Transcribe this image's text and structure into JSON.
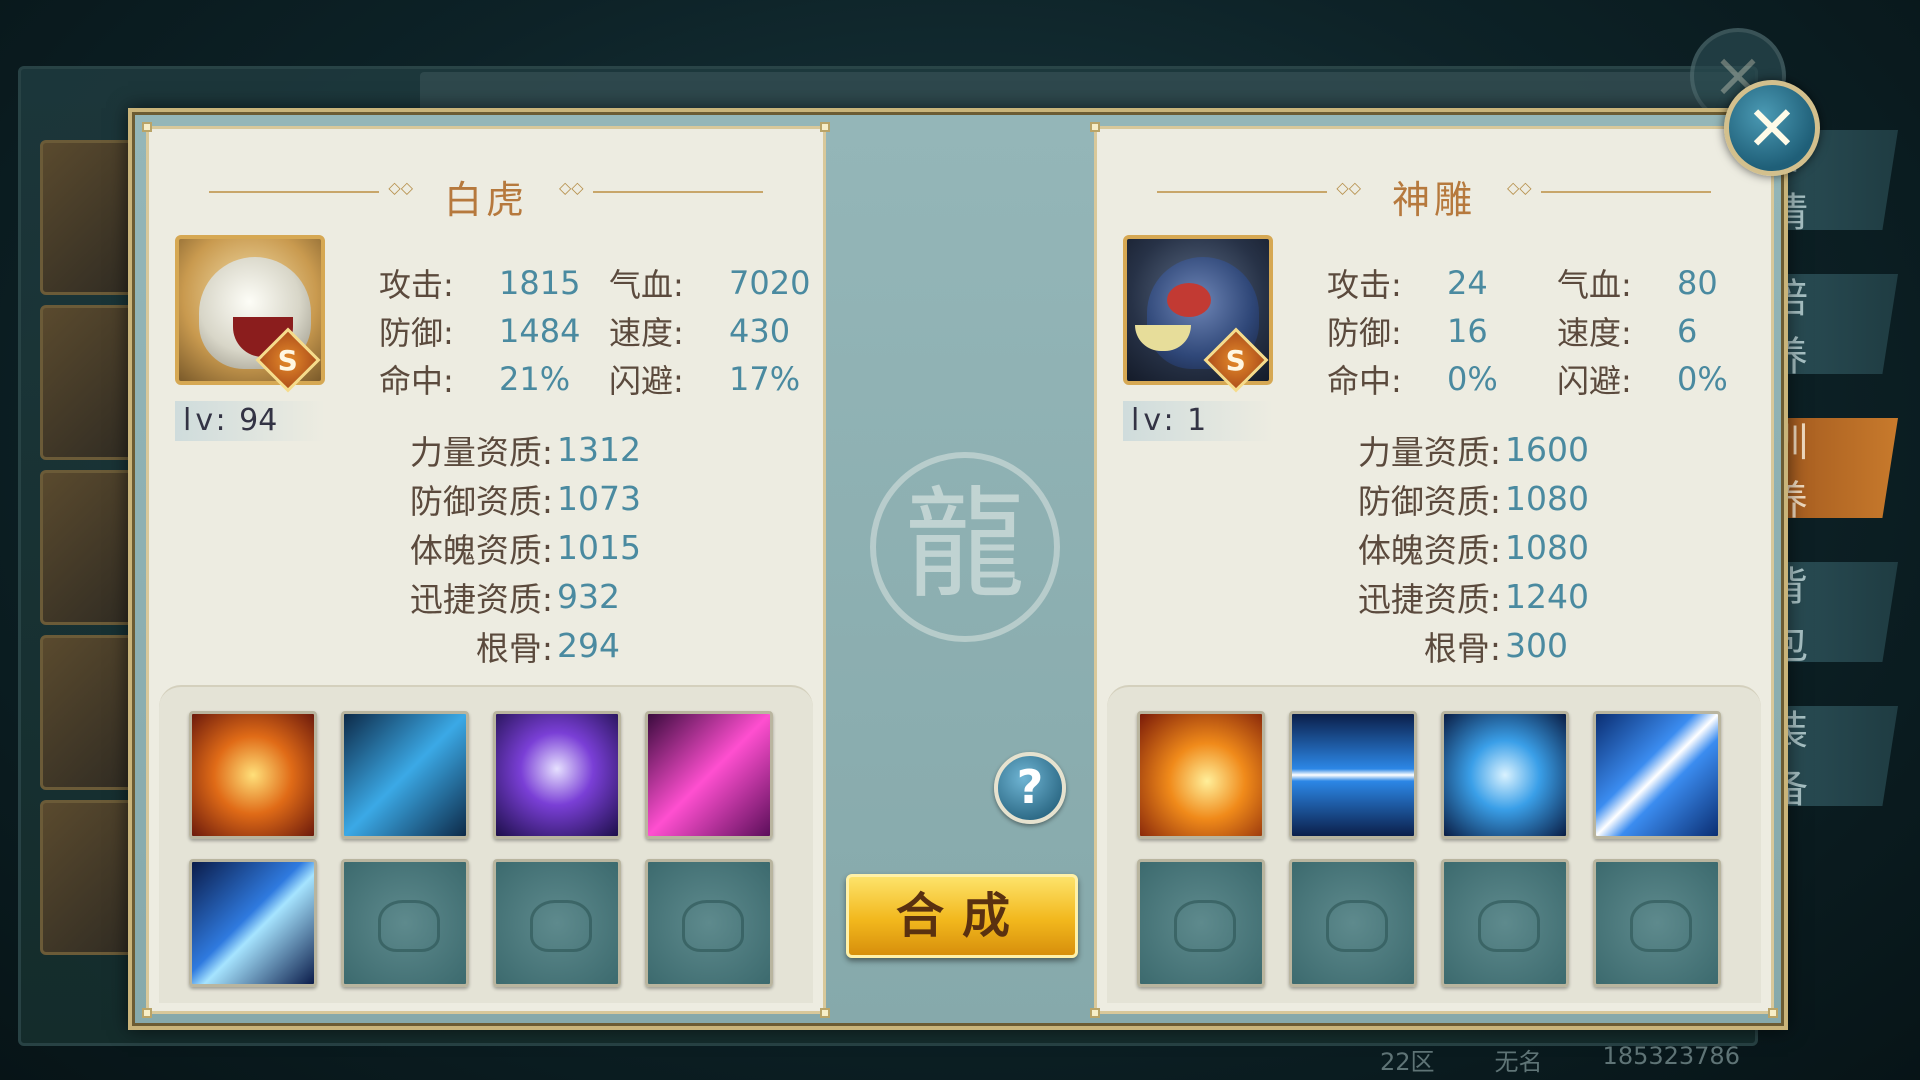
{
  "side_tabs": [
    "详情",
    "培养",
    "训养",
    "背包",
    "装备"
  ],
  "side_tab_active_index": 2,
  "footer": {
    "server": "22区",
    "name": "无名",
    "id": "185323786"
  },
  "close_icon": "close-icon",
  "left_pet": {
    "name": "白虎",
    "rank": "S",
    "level_label": "lv:",
    "level": "94",
    "stats": [
      {
        "label": "攻击:",
        "value": "1815"
      },
      {
        "label": "气血:",
        "value": "7020"
      },
      {
        "label": "防御:",
        "value": "1484"
      },
      {
        "label": "速度:",
        "value": "430"
      },
      {
        "label": "命中:",
        "value": "21%"
      },
      {
        "label": "闪避:",
        "value": "17%"
      }
    ],
    "aptitudes": [
      {
        "label": "力量资质:",
        "value": "1312"
      },
      {
        "label": "防御资质:",
        "value": "1073"
      },
      {
        "label": "体魄资质:",
        "value": "1015"
      },
      {
        "label": "迅捷资质:",
        "value": "932"
      },
      {
        "label": "根骨:",
        "value": "294"
      }
    ],
    "skills": [
      "fire-orb-skill-icon",
      "lightning-skill-icon",
      "purple-vortex-skill-icon",
      "pink-lightning-skill-icon",
      "claw-slash-skill-icon",
      "empty",
      "empty",
      "empty"
    ]
  },
  "right_pet": {
    "name": "神雕",
    "rank": "S",
    "level_label": "lv:",
    "level": "1",
    "stats": [
      {
        "label": "攻击:",
        "value": "24"
      },
      {
        "label": "气血:",
        "value": "80"
      },
      {
        "label": "防御:",
        "value": "16"
      },
      {
        "label": "速度:",
        "value": "6"
      },
      {
        "label": "命中:",
        "value": "0%"
      },
      {
        "label": "闪避:",
        "value": "0%"
      }
    ],
    "aptitudes": [
      {
        "label": "力量资质:",
        "value": "1600"
      },
      {
        "label": "防御资质:",
        "value": "1080"
      },
      {
        "label": "体魄资质:",
        "value": "1080"
      },
      {
        "label": "迅捷资质:",
        "value": "1240"
      },
      {
        "label": "根骨:",
        "value": "300"
      }
    ],
    "skills": [
      "phoenix-flame-skill-icon",
      "speed-streak-skill-icon",
      "blue-heart-skill-icon",
      "blue-arrow-skill-icon",
      "empty",
      "empty",
      "empty",
      "empty"
    ]
  },
  "help_label": "?",
  "combine_label": "合成"
}
